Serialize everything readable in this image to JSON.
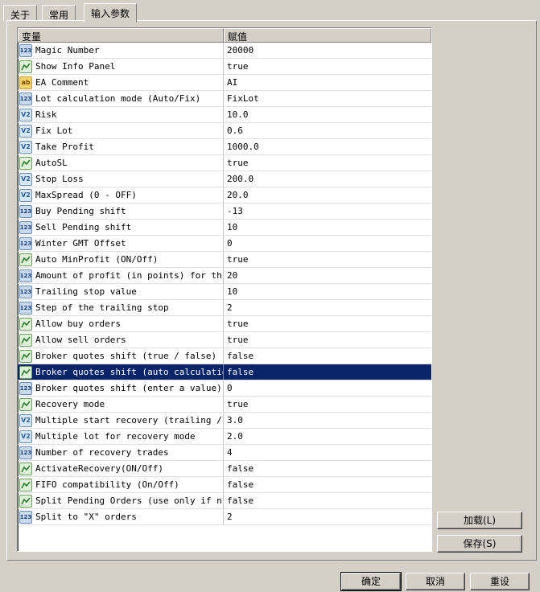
{
  "tabs": [
    {
      "label": "关于"
    },
    {
      "label": "常用"
    },
    {
      "label": "输入参数"
    }
  ],
  "table": {
    "header_name": "变量",
    "header_value": "赋值",
    "rows": [
      {
        "type": "int",
        "icon": "int-type-icon",
        "name": "Magic Number",
        "value": "20000"
      },
      {
        "type": "bool",
        "icon": "bool-type-icon",
        "name": "Show Info Panel",
        "value": "true"
      },
      {
        "type": "str",
        "icon": "string-type-icon",
        "name": "EA Comment",
        "value": "AI"
      },
      {
        "type": "int",
        "icon": "int-type-icon",
        "name": "Lot calculation mode (Auto/Fix)",
        "value": "FixLot"
      },
      {
        "type": "dbl",
        "icon": "double-type-icon",
        "name": "Risk",
        "value": "10.0"
      },
      {
        "type": "dbl",
        "icon": "double-type-icon",
        "name": "Fix Lot",
        "value": "0.6"
      },
      {
        "type": "dbl",
        "icon": "double-type-icon",
        "name": "Take Profit",
        "value": "1000.0"
      },
      {
        "type": "bool",
        "icon": "bool-type-icon",
        "name": "AutoSL",
        "value": "true"
      },
      {
        "type": "dbl",
        "icon": "double-type-icon",
        "name": "Stop Loss",
        "value": "200.0"
      },
      {
        "type": "dbl",
        "icon": "double-type-icon",
        "name": "MaxSpread (0 - OFF)",
        "value": "20.0"
      },
      {
        "type": "int",
        "icon": "int-type-icon",
        "name": "Buy Pending shift",
        "value": "-13"
      },
      {
        "type": "int",
        "icon": "int-type-icon",
        "name": "Sell Pending shift",
        "value": "10"
      },
      {
        "type": "int",
        "icon": "int-type-icon",
        "name": "Winter GMT Offset",
        "value": "0"
      },
      {
        "type": "bool",
        "icon": "bool-type-icon",
        "name": "Auto MinProfit (ON/Off)",
        "value": "true"
      },
      {
        "type": "int",
        "icon": "int-type-icon",
        "name": "Amount of profit (in points) for th...",
        "value": "20"
      },
      {
        "type": "int",
        "icon": "int-type-icon",
        "name": "Trailing stop value",
        "value": "10"
      },
      {
        "type": "int",
        "icon": "int-type-icon",
        "name": "Step of the trailing stop",
        "value": "2"
      },
      {
        "type": "bool",
        "icon": "bool-type-icon",
        "name": "Allow buy orders",
        "value": "true"
      },
      {
        "type": "bool",
        "icon": "bool-type-icon",
        "name": "Allow sell orders",
        "value": "true"
      },
      {
        "type": "bool",
        "icon": "bool-type-icon",
        "name": "Broker quotes shift (true / false)",
        "value": "false"
      },
      {
        "type": "bool",
        "icon": "bool-type-icon",
        "name": "Broker quotes shift (auto calculation)",
        "value": "false",
        "selected": true
      },
      {
        "type": "int",
        "icon": "int-type-icon",
        "name": "Broker quotes shift (enter a value)",
        "value": "0"
      },
      {
        "type": "bool",
        "icon": "bool-type-icon",
        "name": "Recovery mode",
        "value": "true"
      },
      {
        "type": "dbl",
        "icon": "double-type-icon",
        "name": "Multiple start recovery (trailing /...",
        "value": "3.0"
      },
      {
        "type": "dbl",
        "icon": "double-type-icon",
        "name": "Multiple lot for recovery mode",
        "value": "2.0"
      },
      {
        "type": "int",
        "icon": "int-type-icon",
        "name": "Number of recovery trades",
        "value": "4"
      },
      {
        "type": "bool",
        "icon": "bool-type-icon",
        "name": "ActivateRecovery(ON/Off)",
        "value": "false"
      },
      {
        "type": "bool",
        "icon": "bool-type-icon",
        "name": "FIFO compatibility (On/Off)",
        "value": "false"
      },
      {
        "type": "bool",
        "icon": "bool-type-icon",
        "name": "Split Pending Orders (use only if n...",
        "value": "false"
      },
      {
        "type": "int",
        "icon": "int-type-icon",
        "name": "Split to \"X\" orders",
        "value": "2"
      }
    ]
  },
  "icons": {
    "int_glyph": "123",
    "double_glyph": "V2",
    "string_glyph": "ab"
  },
  "buttons": {
    "load": "加载(L)",
    "save": "保存(S)",
    "ok": "确定",
    "cancel": "取消",
    "reset": "重设"
  },
  "colors": {
    "selection": "#0a246a",
    "dialog_bg": "#d4d0c8"
  }
}
